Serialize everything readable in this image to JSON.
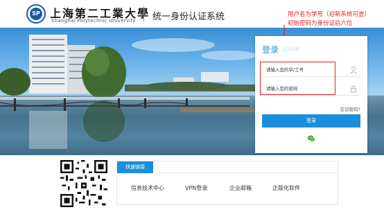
{
  "header": {
    "school_name_cn": "上海第二工業大學",
    "school_name_en": "Shanghai Polytechnic University",
    "logo_text": "SP",
    "system_title": "统一身份认证系统"
  },
  "annotation": {
    "line1": "用户名为学号（迎新系统可查）",
    "line2": "初始密码为身份证后六位",
    "color": "#e02020"
  },
  "login": {
    "title": "登录",
    "subtitle": "LOGIN",
    "username_placeholder": "请输入您的学/工号",
    "password_placeholder": "请输入您的密码",
    "forgot_label": "忘记密码?",
    "submit_label": "登录",
    "accent_color": "#1b8fd9"
  },
  "quick_links": {
    "tab_label": "快速链接",
    "items": [
      "信息技术中心",
      "VPN登录",
      "企业邮箱",
      "正版化软件"
    ]
  }
}
